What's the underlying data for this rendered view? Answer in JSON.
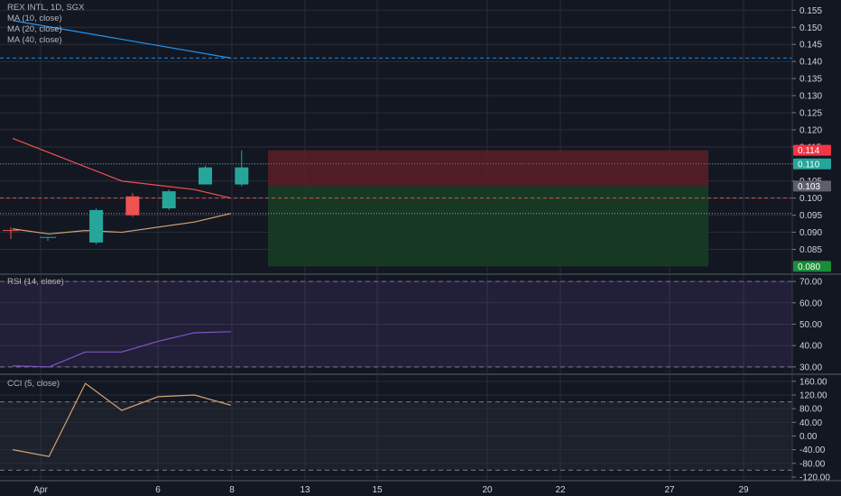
{
  "header": {
    "symbol_title": "REX INTL, 1D, SGX",
    "indicators": [
      "MA (10, close)",
      "MA (20, close)",
      "MA (40, close)"
    ]
  },
  "rsi_panel": {
    "title": "RSI (14, close)"
  },
  "cci_panel": {
    "title": "CCI (5, close)"
  },
  "colors": {
    "background": "#131722",
    "grid": "#2a2e39",
    "up": "#26a69a",
    "down": "#ef5350",
    "ma10": "#ef5350",
    "ma20": "#2196f3",
    "ma40": "#d4a373",
    "rsi_band": "#7e57c2",
    "rsi_line": "#7e57c2",
    "cci_line": "#d4a373",
    "stop_zone": "#5d1f26",
    "target_zone": "#183d25",
    "tag_red": "#f23645",
    "tag_teal": "#26a69a",
    "tag_gray": "#5d606b",
    "tag_green": "#1b8c3a"
  },
  "chart_data": [
    {
      "type": "candlestick",
      "title": "REX INTL, 1D, SGX",
      "x_ticks": [
        "Apr",
        "6",
        "8",
        "13",
        "15",
        "20",
        "22",
        "27",
        "29"
      ],
      "y_ticks": [
        "0.155",
        "0.150",
        "0.145",
        "0.140",
        "0.135",
        "0.130",
        "0.125",
        "0.120",
        "0.115",
        "0.110",
        "0.105",
        "0.100",
        "0.095",
        "0.090",
        "0.085"
      ],
      "ylim": [
        0.078,
        0.158
      ],
      "candles": [
        {
          "day": 0,
          "open": 0.0905,
          "high": 0.0915,
          "low": 0.088,
          "close": 0.0895
        },
        {
          "day": 1,
          "open": 0.0885,
          "high": 0.0885,
          "low": 0.0875,
          "close": 0.0885
        },
        {
          "day": 2,
          "open": 0.087,
          "high": 0.097,
          "low": 0.0865,
          "close": 0.0965
        },
        {
          "day": 3,
          "open": 0.1005,
          "high": 0.1015,
          "low": 0.0945,
          "close": 0.095
        },
        {
          "day": 4,
          "open": 0.097,
          "high": 0.1025,
          "low": 0.0965,
          "close": 0.102
        },
        {
          "day": 5,
          "open": 0.104,
          "high": 0.1095,
          "low": 0.104,
          "close": 0.109
        },
        {
          "day": 6,
          "open": 0.104,
          "high": 0.114,
          "low": 0.1035,
          "close": 0.109
        }
      ],
      "series": [
        {
          "name": "MA (10, close)",
          "x": [
            0,
            3,
            5,
            6
          ],
          "y": [
            0.1175,
            0.105,
            0.1025,
            0.1
          ]
        },
        {
          "name": "MA (20, close)",
          "x": [
            0,
            6
          ],
          "y": [
            0.152,
            0.141
          ]
        },
        {
          "name": "MA (40, close)",
          "x": [
            0,
            1,
            2,
            3,
            5,
            6
          ],
          "y": [
            0.091,
            0.0895,
            0.0905,
            0.09,
            0.093,
            0.0955
          ]
        }
      ],
      "levels": [
        {
          "label": "0.114",
          "value": 0.114,
          "color": "tag_red"
        },
        {
          "label": "0.110",
          "value": 0.11,
          "color": "tag_teal"
        },
        {
          "label": "0.103",
          "value": 0.1035,
          "color": "tag_gray"
        },
        {
          "label": "0.080",
          "value": 0.08,
          "color": "tag_green"
        }
      ],
      "h_lines": [
        {
          "value": 0.141,
          "color": "ma20",
          "style": "dashed"
        },
        {
          "value": 0.11,
          "color": "up",
          "style": "dotted"
        },
        {
          "value": 0.1,
          "color": "down",
          "style": "dashed"
        },
        {
          "value": 0.0955,
          "color": "ma40",
          "style": "dotted"
        }
      ],
      "position_tool": {
        "entry": 0.1035,
        "stop": 0.114,
        "target": 0.08
      }
    },
    {
      "type": "line",
      "title": "RSI (14, close)",
      "y_ticks": [
        "70.00",
        "60.00",
        "50.00",
        "40.00",
        "30.00"
      ],
      "ylim": [
        27,
        73
      ],
      "band": [
        30,
        70
      ],
      "series": [
        {
          "x": [
            0,
            1,
            2,
            3,
            4,
            5,
            6
          ],
          "y": [
            30.5,
            30,
            37,
            37,
            42,
            46,
            46.5
          ]
        }
      ]
    },
    {
      "type": "line",
      "title": "CCI (5, close)",
      "y_ticks": [
        "160.00",
        "120.00",
        "80.00",
        "40.00",
        "0.00",
        "-40.00",
        "-80.00",
        "-120.00"
      ],
      "ylim": [
        -128,
        178
      ],
      "band": [
        -100,
        100
      ],
      "series": [
        {
          "x": [
            0,
            1,
            2,
            3,
            4,
            5,
            6
          ],
          "y": [
            -40,
            -60,
            154,
            75,
            115,
            120,
            90
          ]
        }
      ]
    }
  ]
}
